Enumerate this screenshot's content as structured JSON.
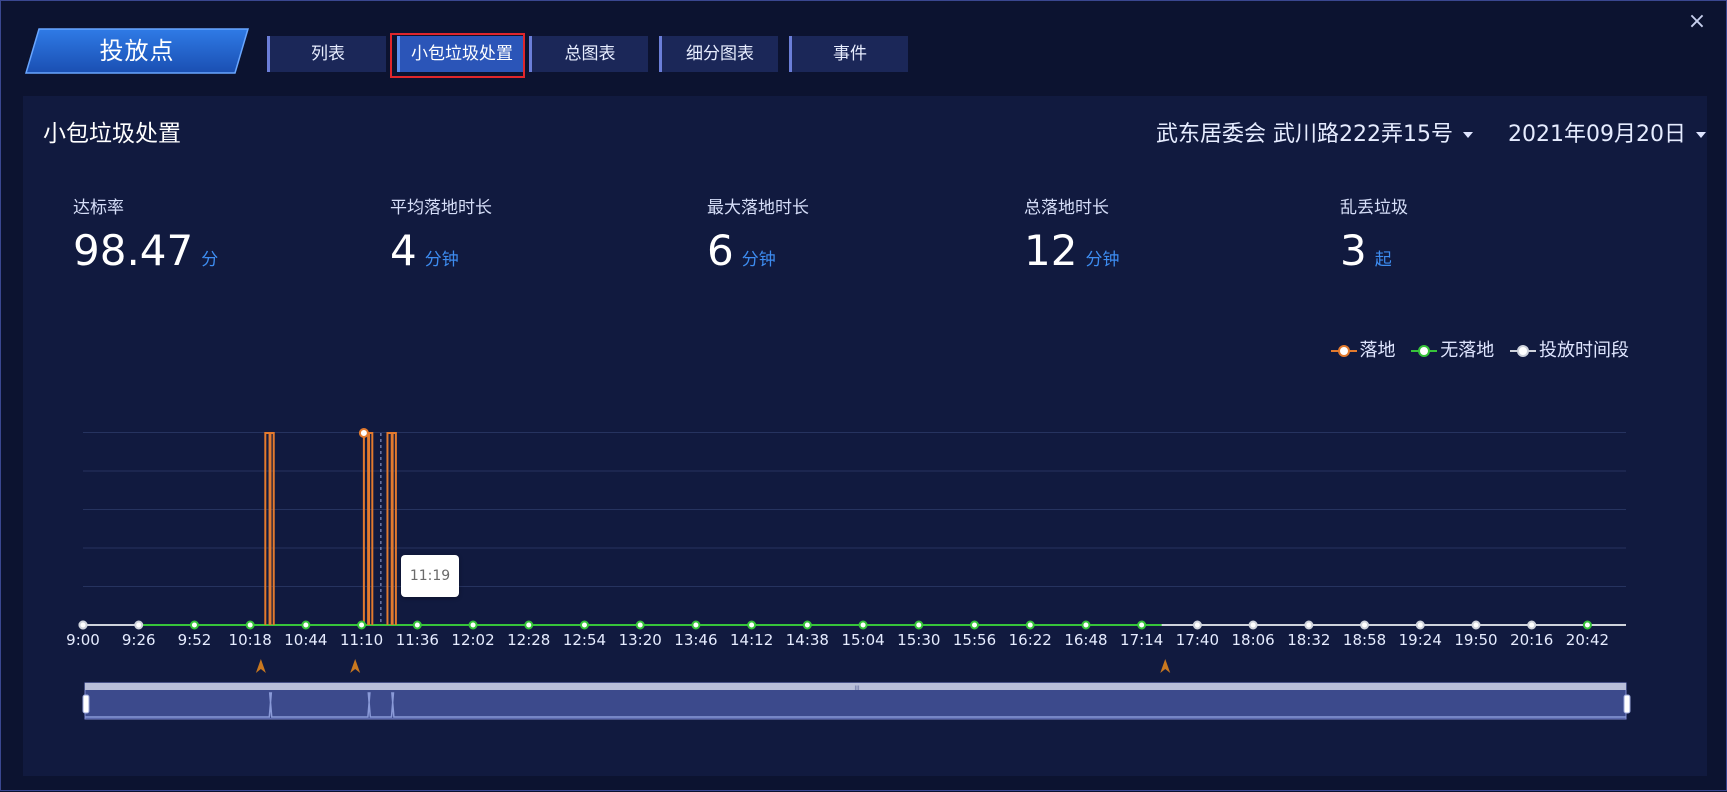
{
  "window": {
    "close_label": "×"
  },
  "header": {
    "title": "投放点",
    "tabs": [
      {
        "label": "列表",
        "active": false
      },
      {
        "label": "小包垃圾处置",
        "active": true
      },
      {
        "label": "总图表",
        "active": false
      },
      {
        "label": "细分图表",
        "active": false
      },
      {
        "label": "事件",
        "active": false
      }
    ]
  },
  "panel": {
    "title": "小包垃圾处置",
    "location_select": "武东居委会 武川路222弄15号",
    "date_select": "2021年09月20日"
  },
  "stats": [
    {
      "label": "达标率",
      "value": "98.47",
      "unit": "分"
    },
    {
      "label": "平均落地时长",
      "value": "4",
      "unit": "分钟"
    },
    {
      "label": "最大落地时长",
      "value": "6",
      "unit": "分钟"
    },
    {
      "label": "总落地时长",
      "value": "12",
      "unit": "分钟"
    },
    {
      "label": "乱丢垃圾",
      "value": "3",
      "unit": "起"
    }
  ],
  "legend": {
    "landed": "落地",
    "not_landed": "无落地",
    "drop_period": "投放时间段"
  },
  "colors": {
    "landed": "#e27a2e",
    "not_landed": "#37c43a",
    "drop_period": "#cfd3dc",
    "accent": "#3d8cf0",
    "highlight": "#e0262b"
  },
  "tooltip": {
    "text": "11:19"
  },
  "chart_data": {
    "type": "line",
    "x_tick_labels": [
      "9:00",
      "9:26",
      "9:52",
      "10:18",
      "10:44",
      "11:10",
      "11:36",
      "12:02",
      "12:28",
      "12:54",
      "13:20",
      "13:46",
      "14:12",
      "14:38",
      "15:04",
      "15:30",
      "15:56",
      "16:22",
      "16:48",
      "17:14",
      "17:40",
      "18:06",
      "18:32",
      "18:58",
      "19:24",
      "19:50",
      "20:16",
      "20:42"
    ],
    "x_range": [
      "9:00",
      "21:00"
    ],
    "y_range": [
      0,
      1
    ],
    "grid": true,
    "legend_position": "top-right",
    "series": [
      {
        "name": "落地",
        "segments": [
          {
            "start": "10:26",
            "end": "10:29"
          },
          {
            "start": "11:12",
            "end": "11:15"
          },
          {
            "start": "11:23",
            "end": "11:26"
          }
        ]
      },
      {
        "name": "无落地",
        "start": "9:52",
        "end": "17:14"
      },
      {
        "name": "投放时间段",
        "points": [
          "9:00",
          "9:26",
          "17:40",
          "18:06",
          "18:32",
          "18:58",
          "19:24",
          "19:50",
          "20:16"
        ]
      }
    ],
    "event_markers": [
      "10:23",
      "11:07",
      "17:25"
    ],
    "cursor_time": "11:19"
  },
  "zoom": {
    "handle_label": "III"
  }
}
